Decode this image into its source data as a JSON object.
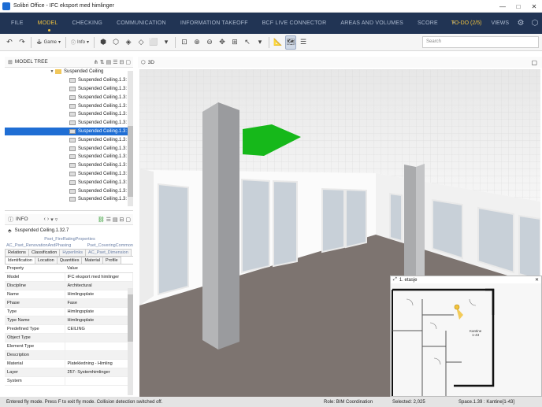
{
  "window": {
    "title": "Solibri Office - IFC eksport med himlinger",
    "controls": [
      "—",
      "□",
      "✕"
    ]
  },
  "menu": {
    "items": [
      "FILE",
      "MODEL",
      "CHECKING",
      "COMMUNICATION",
      "INFORMATION TAKEOFF",
      "BCF LIVE CONNECTOR",
      "AREAS AND VOLUMES",
      "SCORE",
      "+"
    ],
    "active_index": 1,
    "todo": "TO-DO (2/5)",
    "views": "VIEWS"
  },
  "toolbar": {
    "game_label": "Game",
    "info_label": "Info",
    "search_placeholder": "Search"
  },
  "model_tree": {
    "title": "MODEL TREE",
    "items": [
      {
        "label": "Suspended Ceiling",
        "type": "folder"
      },
      {
        "label": "Suspended Ceiling.1.3:",
        "type": "item"
      },
      {
        "label": "Suspended Ceiling.1.3:",
        "type": "item"
      },
      {
        "label": "Suspended Ceiling.1.3:",
        "type": "item"
      },
      {
        "label": "Suspended Ceiling.1.3:",
        "type": "item"
      },
      {
        "label": "Suspended Ceiling.1.3:",
        "type": "item"
      },
      {
        "label": "Suspended Ceiling.1.3:",
        "type": "item"
      },
      {
        "label": "Suspended Ceiling.1.3:",
        "type": "item",
        "selected": true
      },
      {
        "label": "Suspended Ceiling.1.3:",
        "type": "item"
      },
      {
        "label": "Suspended Ceiling.1.3:",
        "type": "item"
      },
      {
        "label": "Suspended Ceiling.1.3:",
        "type": "item"
      },
      {
        "label": "Suspended Ceiling.1.3:",
        "type": "item"
      },
      {
        "label": "Suspended Ceiling.1.3:",
        "type": "item"
      },
      {
        "label": "Suspended Ceiling.1.3:",
        "type": "item"
      },
      {
        "label": "Suspended Ceiling.1.3:",
        "type": "item"
      },
      {
        "label": "Suspended Ceiling.1.3:",
        "type": "item"
      }
    ]
  },
  "info": {
    "title": "INFO",
    "object": "Suspended Ceiling.1.32.7",
    "psets_row1": [
      "Pset_FireRatingProperties"
    ],
    "psets_row2": [
      "AC_Pset_RenovationAndPhasing",
      "Pset_CoveringCommon"
    ],
    "tabs_row1": [
      "Relations",
      "Classification",
      "Hyperlinks",
      "AC_Pset_Dimension"
    ],
    "tabs_row2": [
      "Identification",
      "Location",
      "Quantities",
      "Material",
      "Profile"
    ],
    "columns": [
      "Property",
      "Value"
    ],
    "rows": [
      {
        "p": "Model",
        "v": "IFC eksport med himlinger"
      },
      {
        "p": "Discipline",
        "v": "Architectural"
      },
      {
        "p": "Name",
        "v": "Himlingsplate"
      },
      {
        "p": "Phase",
        "v": "Fase"
      },
      {
        "p": "Type",
        "v": "Himlingsplate"
      },
      {
        "p": "Type Name",
        "v": "Himlingsplate"
      },
      {
        "p": "Predefined Type",
        "v": "CEILING"
      },
      {
        "p": "Object Type",
        "v": ""
      },
      {
        "p": "Element Type",
        "v": ""
      },
      {
        "p": "Description",
        "v": ""
      },
      {
        "p": "Material",
        "v": "Platekledning - Himling"
      },
      {
        "p": "Layer",
        "v": "257- Systemhimlinger"
      },
      {
        "p": "System",
        "v": ""
      }
    ]
  },
  "view3d": {
    "title": "3D",
    "minimap_label": "1. etasje",
    "minimap_room": "Kantine",
    "minimap_room_no": "1-43"
  },
  "status": {
    "left": "Entered fly mode. Press F to exit fly mode. Collision detection switched off.",
    "role": "Role: BIM Coordination",
    "selected": "Selected: 2,025",
    "space": "Space.1.39 : Kantine[1-43]"
  },
  "colors": {
    "menu_bg": "#213454",
    "accent": "#f2c33d",
    "selection": "#1f6ed4",
    "highlight_green": "#16b81a"
  }
}
